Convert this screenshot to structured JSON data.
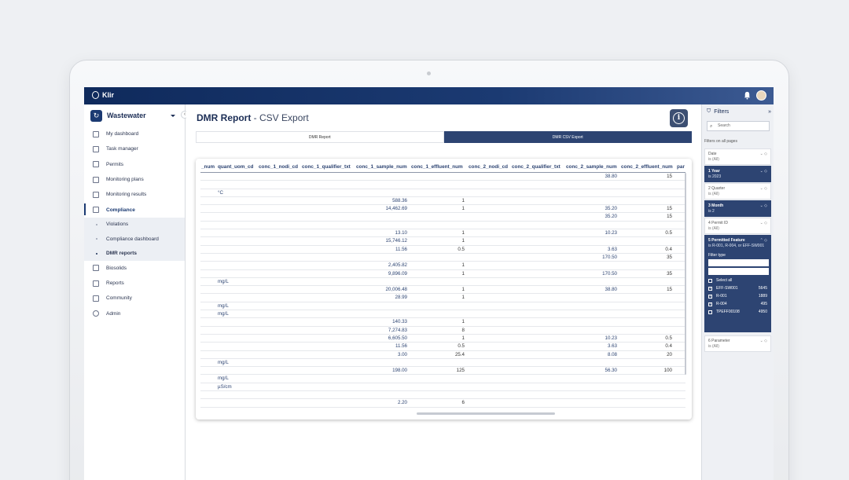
{
  "app": {
    "logo": "Klir",
    "product": "Wastewater"
  },
  "sidebar": {
    "items": [
      {
        "label": "My dashboard",
        "icon": "dashboard-icon"
      },
      {
        "label": "Task manager",
        "icon": "task-icon"
      },
      {
        "label": "Permits",
        "icon": "permit-icon"
      },
      {
        "label": "Monitoring plans",
        "icon": "flask-icon"
      },
      {
        "label": "Monitoring results",
        "icon": "results-icon"
      },
      {
        "label": "Compliance",
        "icon": "compliance-icon"
      }
    ],
    "compliance_sub": [
      {
        "label": "Violations"
      },
      {
        "label": "Compliance dashboard"
      },
      {
        "label": "DMR reports"
      }
    ],
    "items_after": [
      {
        "label": "Biosolids",
        "icon": "biosolids-icon"
      },
      {
        "label": "Reports",
        "icon": "reports-icon"
      },
      {
        "label": "Community",
        "icon": "community-icon"
      },
      {
        "label": "Admin",
        "icon": "gear-icon"
      }
    ]
  },
  "page": {
    "title": "DMR Report",
    "subtitle": "- CSV Export",
    "info_glyph": "i"
  },
  "tabs": [
    {
      "label": "DMR Report"
    },
    {
      "label": "DMR CSV Export"
    }
  ],
  "table": {
    "headers": [
      "_num",
      "quant_uom_cd",
      "conc_1_nodi_cd",
      "conc_1_qualifier_txt",
      "conc_1_sample_num",
      "conc_1_effluent_num",
      "conc_2_nodi_cd",
      "conc_2_qualifier_txt",
      "conc_2_sample_num",
      "conc_2_effluent_num",
      "par"
    ],
    "rows": [
      {
        "uom": "",
        "s1": "",
        "e1": "",
        "s2": "38.80",
        "e2": "15"
      },
      {
        "uom": "",
        "s1": "",
        "e1": "",
        "s2": "",
        "e2": ""
      },
      {
        "uom": "°C",
        "s1": "",
        "e1": "",
        "s2": "",
        "e2": ""
      },
      {
        "uom": "",
        "s1": "588.36",
        "e1": "1",
        "s2": "",
        "e2": ""
      },
      {
        "uom": "",
        "s1": "14,462.69",
        "e1": "1",
        "s2": "35.20",
        "e2": "15"
      },
      {
        "uom": "",
        "s1": "",
        "e1": "",
        "s2": "35.20",
        "e2": "15"
      },
      {
        "uom": "",
        "s1": "",
        "e1": "",
        "s2": "",
        "e2": ""
      },
      {
        "uom": "",
        "s1": "13.10",
        "e1": "1",
        "s2": "10.23",
        "e2": "0.5"
      },
      {
        "uom": "",
        "s1": "15,746.12",
        "e1": "1",
        "s2": "",
        "e2": ""
      },
      {
        "uom": "",
        "s1": "11.56",
        "e1": "0.5",
        "s2": "3.63",
        "e2": "0.4"
      },
      {
        "uom": "",
        "s1": "",
        "e1": "",
        "s2": "170.50",
        "e2": "35"
      },
      {
        "uom": "",
        "s1": "2,405.82",
        "e1": "1",
        "s2": "",
        "e2": ""
      },
      {
        "uom": "",
        "s1": "9,896.09",
        "e1": "1",
        "s2": "170.50",
        "e2": "35"
      },
      {
        "uom": "mg/L",
        "s1": "",
        "e1": "",
        "s2": "",
        "e2": ""
      },
      {
        "uom": "",
        "s1": "20,006.48",
        "e1": "1",
        "s2": "38.80",
        "e2": "15"
      },
      {
        "uom": "",
        "s1": "28.99",
        "e1": "1",
        "s2": "",
        "e2": ""
      },
      {
        "uom": "mg/L",
        "s1": "",
        "e1": "",
        "s2": "",
        "e2": ""
      },
      {
        "uom": "mg/L",
        "s1": "",
        "e1": "",
        "s2": "",
        "e2": ""
      },
      {
        "uom": "",
        "s1": "140.33",
        "e1": "1",
        "s2": "",
        "e2": ""
      },
      {
        "uom": "",
        "s1": "7,274.83",
        "e1": "8",
        "s2": "",
        "e2": ""
      },
      {
        "uom": "",
        "s1": "6,605.50",
        "e1": "1",
        "s2": "10.23",
        "e2": "0.5"
      },
      {
        "uom": "",
        "s1": "11.56",
        "e1": "0.5",
        "s2": "3.63",
        "e2": "0.4"
      },
      {
        "uom": "",
        "s1": "3.00",
        "e1": "25.4",
        "s2": "8.08",
        "e2": "20"
      },
      {
        "uom": "mg/L",
        "s1": "",
        "e1": "",
        "s2": "",
        "e2": ""
      },
      {
        "uom": "",
        "s1": "198.00",
        "e1": "125",
        "s2": "56.30",
        "e2": "100"
      },
      {
        "uom": "mg/L",
        "s1": "",
        "e1": "",
        "s2": "",
        "e2": ""
      },
      {
        "uom": "µS/cm",
        "s1": "",
        "e1": "",
        "s2": "",
        "e2": ""
      },
      {
        "uom": "",
        "s1": "",
        "e1": "",
        "s2": "",
        "e2": ""
      },
      {
        "uom": "",
        "s1": "2.20",
        "e1": "6",
        "s2": "",
        "e2": ""
      },
      {
        "uom": "",
        "s1": "",
        "e1": "",
        "s2": "",
        "e2": ""
      }
    ]
  },
  "filters": {
    "title": "Filters",
    "search_placeholder": "Search",
    "section_label": "Filters on all pages",
    "cards": [
      {
        "name": "Date",
        "value": "is (All)",
        "dark": false
      },
      {
        "name": "1 Year",
        "value": "is 2023",
        "dark": true
      },
      {
        "name": "2 Quarter",
        "value": "is (All)",
        "dark": false
      },
      {
        "name": "3 Month",
        "value": "is 2",
        "dark": true
      },
      {
        "name": "4 Permit ID",
        "value": "is (All)",
        "dark": false
      }
    ],
    "expanded": {
      "name": "5 Permitted Feature",
      "value": "is R-001, R-004, or EFF-SW001",
      "type_label": "Filter type",
      "options": [
        {
          "label": "Select all",
          "count": "",
          "checked": false
        },
        {
          "label": "EFF-SW001",
          "count": "5645",
          "checked": true
        },
        {
          "label": "R-001",
          "count": "1889",
          "checked": true
        },
        {
          "label": "R-004",
          "count": "495",
          "checked": true
        },
        {
          "label": "TPEFF00108",
          "count": "4950",
          "checked": false
        }
      ]
    },
    "last": {
      "name": "6 Parameter",
      "value": "is (All)"
    }
  }
}
